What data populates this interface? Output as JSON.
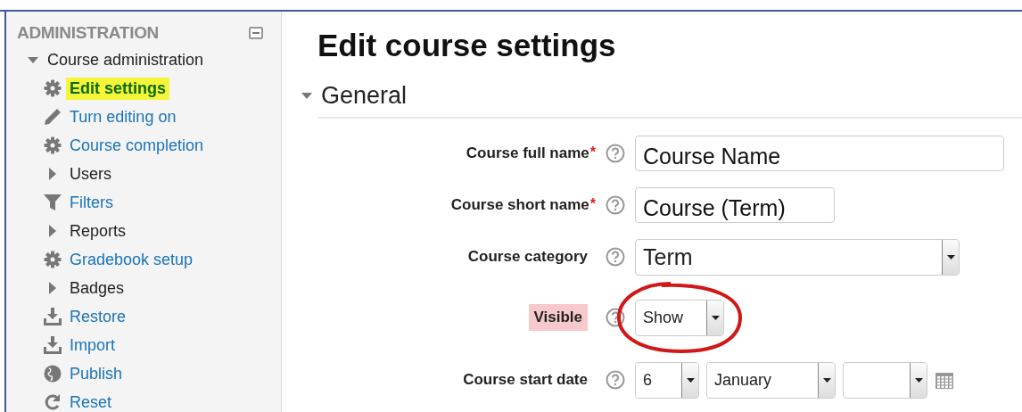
{
  "sidebar": {
    "title": "ADMINISTRATION",
    "section": {
      "label": "Course administration",
      "expanded": true,
      "items": [
        {
          "label": "Edit settings",
          "kind": "gear",
          "selected": true
        },
        {
          "label": "Turn editing on",
          "kind": "pencil",
          "selected": false
        },
        {
          "label": "Course completion",
          "kind": "gear",
          "selected": false
        },
        {
          "label": "Users",
          "kind": "branch",
          "selected": false
        },
        {
          "label": "Filters",
          "kind": "filter",
          "selected": false
        },
        {
          "label": "Reports",
          "kind": "branch",
          "selected": false
        },
        {
          "label": "Gradebook setup",
          "kind": "gear",
          "selected": false
        },
        {
          "label": "Badges",
          "kind": "branch",
          "selected": false
        },
        {
          "label": "Restore",
          "kind": "download",
          "selected": false
        },
        {
          "label": "Import",
          "kind": "download",
          "selected": false
        },
        {
          "label": "Publish",
          "kind": "globe",
          "selected": false
        },
        {
          "label": "Reset",
          "kind": "reset",
          "selected": false
        }
      ]
    }
  },
  "page": {
    "title": "Edit course settings",
    "section": {
      "title": "General",
      "expanded": true
    },
    "fields": [
      {
        "label": "Course full name",
        "required_mark": "*",
        "highlighted": false,
        "kind": "text",
        "value": "Course Name",
        "circled": false
      },
      {
        "label": "Course short name",
        "required_mark": "*",
        "highlighted": false,
        "kind": "short-text",
        "value": "Course (Term)",
        "circled": false
      },
      {
        "label": "Course category",
        "highlighted": false,
        "kind": "select",
        "value": "Term",
        "circled": false
      },
      {
        "label": "Visible",
        "highlighted": true,
        "kind": "small-select",
        "value": "Show",
        "circled": true
      },
      {
        "label": "Course start date",
        "highlighted": false,
        "kind": "date",
        "day": "6",
        "month": "January",
        "circled": false
      }
    ]
  }
}
